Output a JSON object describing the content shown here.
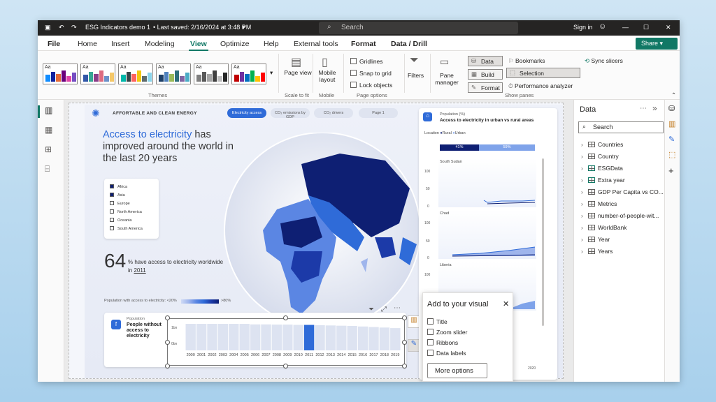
{
  "titlebar": {
    "doc": "ESG Indicators demo 1",
    "saved": "• Last saved: 2/16/2024 at 3:48 PM",
    "search": "Search",
    "signin": "Sign in"
  },
  "menu": [
    "File",
    "Home",
    "Insert",
    "Modeling",
    "View",
    "Optimize",
    "Help",
    "External tools",
    "Format",
    "Data / Drill"
  ],
  "active_menu": "View",
  "share": "Share",
  "ribbon": {
    "themes_label": "Themes",
    "page_view": "Page view",
    "scale_label": "Scale to fit",
    "mobile_layout": "Mobile layout",
    "mobile_label": "Mobile",
    "gridlines": "Gridlines",
    "snap": "Snap to grid",
    "lock": "Lock objects",
    "page_options_label": "Page options",
    "filters": "Filters",
    "pane_manager": "Pane manager",
    "data_btn": "Data",
    "build_btn": "Build",
    "format_btn": "Format",
    "bookmarks": "Bookmarks",
    "selection": "Selection",
    "perf": "Performance analyzer",
    "sync": "Sync slicers",
    "show_panes_label": "Show panes"
  },
  "report": {
    "header": "AFFORTABLE AND CLEAN ENERGY",
    "tabs": [
      "Electricity access",
      "CO₂ emissions by GDP",
      "CO₂ drivers",
      "Page 1"
    ],
    "title_hl": "Access to electricity",
    "title_rest": " has improved around the world in the last 20 years",
    "legend": [
      "Africa",
      "Asia",
      "Europe",
      "North America",
      "Oceania",
      "South America"
    ],
    "stat_num": "64",
    "stat_text": "% have access to electricity worldwide in ",
    "stat_year": "2011",
    "scale_label": "Population with access to electricity:",
    "scale_lo": "<20%",
    "scale_hi": ">80%",
    "pop_label": "Population",
    "pop_title": "People without access to electricity",
    "pop_y1": "1bn",
    "pop_y2": "0bn",
    "years": [
      "2000",
      "2001",
      "2002",
      "2003",
      "2004",
      "2005",
      "2006",
      "2007",
      "2008",
      "2009",
      "2010",
      "2011",
      "2012",
      "2013",
      "2014",
      "2015",
      "2016",
      "2017",
      "2018",
      "2019"
    ],
    "right_label": "Population (%)",
    "right_title": "Access to electricity in urban vs rural areas",
    "loc_label": "Location",
    "rural": "Rural",
    "urban": "Urban",
    "rural_pct": "41%",
    "urban_pct": "59%",
    "countries": [
      "South Sudan",
      "Chad",
      "Liberia"
    ],
    "yt": [
      "100",
      "50",
      "0"
    ],
    "x_end": "2020"
  },
  "popup": {
    "title": "Add to your visual",
    "options": [
      "Title",
      "Zoom slider",
      "Ribbons",
      "Data labels"
    ],
    "more": "More options"
  },
  "datapane": {
    "title": "Data",
    "search": "Search",
    "fields": [
      "Countries",
      "Country",
      "ESGData",
      "Extra year",
      "GDP Per Capita vs CO...",
      "Metrics",
      "number-of-people-wit...",
      "WorldBank",
      "Year",
      "Years"
    ]
  },
  "chart_data": {
    "type": "bar",
    "title": "People without access to electricity",
    "categories": [
      "2000",
      "2001",
      "2002",
      "2003",
      "2004",
      "2005",
      "2006",
      "2007",
      "2008",
      "2009",
      "2010",
      "2011",
      "2012",
      "2013",
      "2014",
      "2015",
      "2016",
      "2017",
      "2018",
      "2019"
    ],
    "values": [
      1.0,
      1.0,
      1.0,
      1.0,
      1.0,
      1.0,
      0.98,
      0.98,
      0.97,
      0.97,
      0.96,
      0.96,
      0.95,
      0.94,
      0.93,
      0.92,
      0.9,
      0.88,
      0.86,
      0.84
    ],
    "ylim": [
      0,
      1
    ],
    "highlight": "2011"
  },
  "colors": {
    "accent": "#2f6bd8",
    "dark": "#0e1f73",
    "green": "#117865"
  }
}
